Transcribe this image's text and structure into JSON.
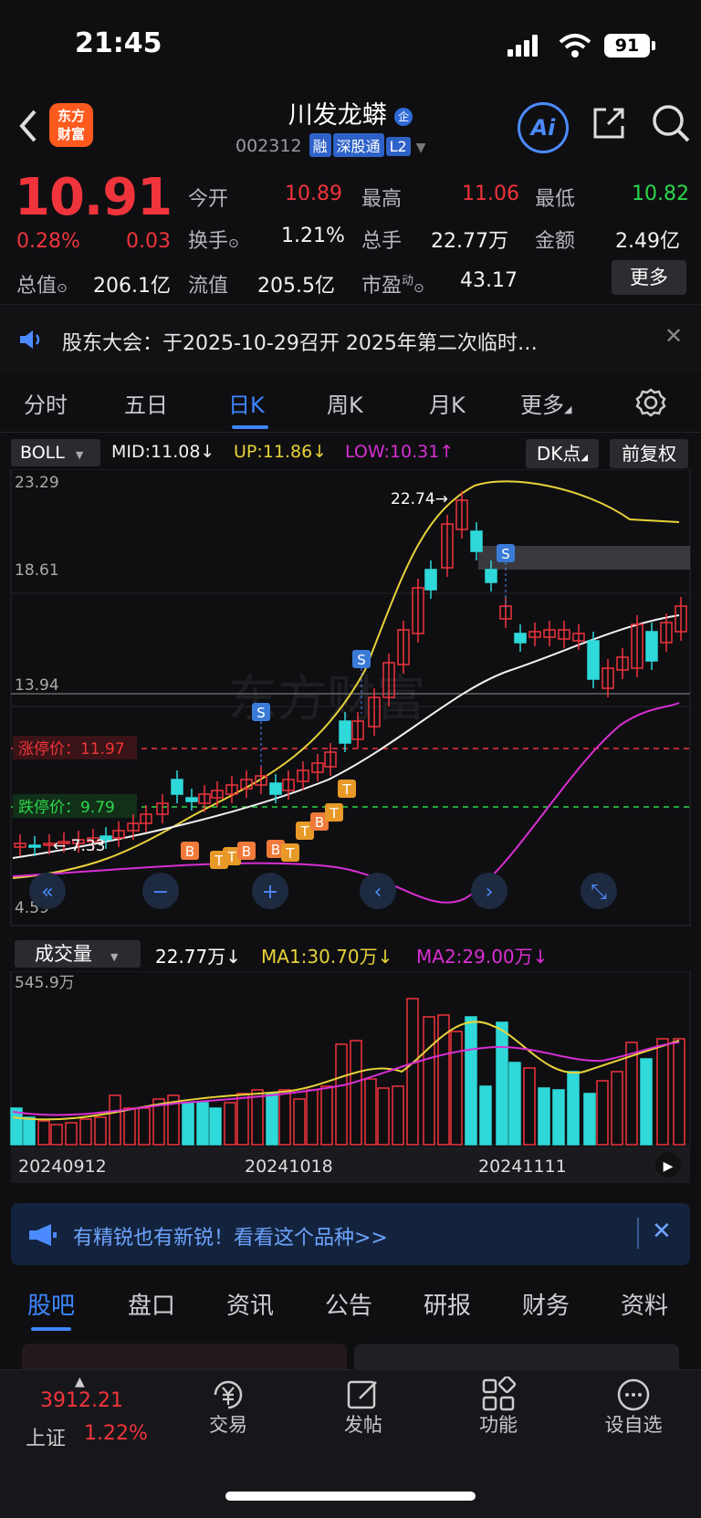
{
  "status": {
    "time": "21:45",
    "battery": "91"
  },
  "header": {
    "logo_line1": "东方",
    "logo_line2": "财富",
    "title": "川发龙蟒",
    "code": "002312",
    "tags": [
      "融",
      "深股通",
      "L2"
    ],
    "ai": "Ai"
  },
  "quote": {
    "price": "10.91",
    "pct": "0.28%",
    "change": "0.03",
    "open_l": "今开",
    "open": "10.89",
    "high_l": "最高",
    "high": "11.06",
    "low_l": "最低",
    "low": "10.82",
    "turnover_l": "换手",
    "turnover": "1.21%",
    "vol_l": "总手",
    "vol": "22.77万",
    "amount_l": "金额",
    "amount": "2.49亿",
    "mcap_l": "总值",
    "mcap": "206.1亿",
    "fcap_l": "流值",
    "fcap": "205.5亿",
    "pe_l": "市盈",
    "pe_sup": "动",
    "pe": "43.17",
    "more": "更多"
  },
  "notice": {
    "text": "股东大会：于2025-10-29召开 2025年第二次临时…"
  },
  "tabs": [
    "分时",
    "五日",
    "日K",
    "周K",
    "月K",
    "更多"
  ],
  "kline": {
    "indicator": "BOLL",
    "mid": "MID:11.08",
    "up": "UP:11.86",
    "low": "LOW:10.31",
    "dk": "DK点",
    "fq": "前复权",
    "y_labels": [
      "23.29",
      "18.61",
      "13.94",
      "4.59"
    ],
    "max_label": "22.74",
    "min_label": "7.33",
    "limit_up": "涨停价：11.97",
    "limit_down": "跌停价：9.79",
    "watermark": "东方财富"
  },
  "volume": {
    "title": "成交量",
    "val": "22.77万",
    "ma1": "MA1:30.70万",
    "ma2": "MA2:29.00万",
    "ymax": "545.9万",
    "dates": [
      "20240912",
      "20241018",
      "20241111"
    ]
  },
  "ad": {
    "text": "有精锐也有新锐！看看这个品种>>"
  },
  "bottom_tabs": [
    "股吧",
    "盘口",
    "资讯",
    "公告",
    "研报",
    "财务",
    "资料"
  ],
  "nav": {
    "index_val": "3912.21",
    "index_name": "上证",
    "index_pct": "1.22%",
    "items": [
      "交易",
      "发帖",
      "功能",
      "设自选"
    ]
  },
  "colors": {
    "up": "#f0343c",
    "down": "#2fd9d9",
    "mid": "#f2f2f2",
    "upper": "#e8d23a",
    "lower": "#d82fd2",
    "accent": "#2f7bff"
  }
}
